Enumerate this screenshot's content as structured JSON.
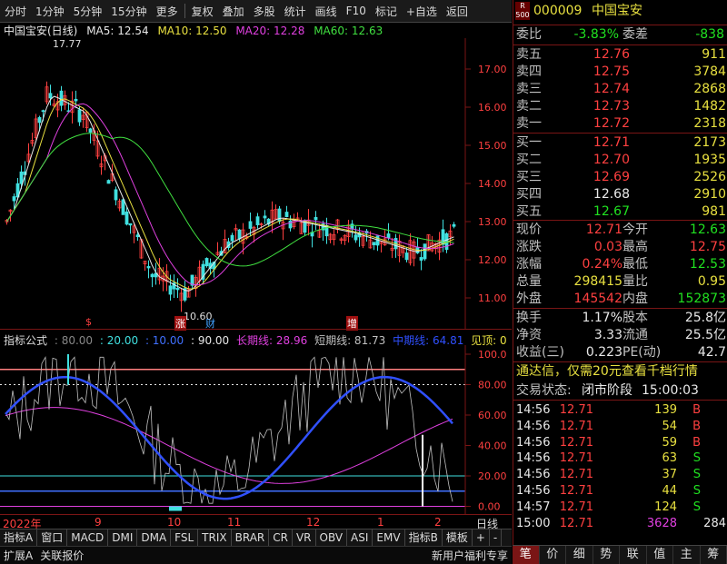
{
  "toolbar": {
    "items": [
      "分时",
      "1分钟",
      "5分钟",
      "15分钟",
      "更多",
      "复权",
      "叠加",
      "多股",
      "统计",
      "画线",
      "F10",
      "标记",
      "+自选",
      "返回"
    ]
  },
  "stock": {
    "title": "中国宝安(日线)",
    "code": "000009",
    "name": "中国宝安",
    "badge_top": "R",
    "badge_bottom": "500"
  },
  "ma": {
    "ma5": "MA5: 12.54",
    "ma10": "MA10: 12.50",
    "ma20": "MA20: 12.28",
    "ma60": "MA60: 12.63"
  },
  "colors": {
    "ma5": "#e8e8e8",
    "ma10": "#e8e040",
    "ma20": "#e040e0",
    "ma60": "#40e040",
    "up": "#ff4040",
    "down": "#40e0e0",
    "axis_frame": "#7a1515"
  },
  "main_chart": {
    "yaxis": [
      "17.00",
      "16.00",
      "15.00",
      "14.00",
      "13.00",
      "12.00",
      "11.00"
    ],
    "high_label": "17.77",
    "low_label": "10.60",
    "markers": [
      "$",
      "涨",
      "财",
      "增"
    ]
  },
  "indicator": {
    "name": "指标公式",
    "params": [
      ": 80.00",
      ": 20.00",
      ": 10.00",
      ": 90.00"
    ],
    "long_line": "长期线: 28.96",
    "short_line": "短期线: 81.73",
    "mid_line": "中期线: 64.81",
    "top_label": "见顶: 0",
    "yaxis": [
      "100.0",
      "80.00",
      "60.00",
      "40.00",
      "20.00",
      "0.00"
    ]
  },
  "date_axis": {
    "labels": [
      "2022年",
      "9",
      "10",
      "11",
      "12",
      "1",
      "2"
    ],
    "right_label": "日线"
  },
  "tabs": [
    "指标A",
    "窗口",
    "MACD",
    "DMI",
    "DMA",
    "FSL",
    "TRIX",
    "BRAR",
    "CR",
    "VR",
    "OBV",
    "ASI",
    "EMV",
    "指标B",
    "模板",
    "+",
    "-"
  ],
  "statusbar": {
    "left": [
      "扩展A",
      "关联报价"
    ],
    "right": "新用户福利专享"
  },
  "quote": {
    "webi_label": "委比",
    "webi_value": "-3.83%",
    "weicha_label": "委差",
    "weicha_value": "-838",
    "asks": [
      {
        "label": "卖五",
        "price": "12.76",
        "vol": "911"
      },
      {
        "label": "卖四",
        "price": "12.75",
        "vol": "3784"
      },
      {
        "label": "卖三",
        "price": "12.74",
        "vol": "2868"
      },
      {
        "label": "卖二",
        "price": "12.73",
        "vol": "1482"
      },
      {
        "label": "卖一",
        "price": "12.72",
        "vol": "2318"
      }
    ],
    "bids": [
      {
        "label": "买一",
        "price": "12.71",
        "vol": "2173"
      },
      {
        "label": "买二",
        "price": "12.70",
        "vol": "1935"
      },
      {
        "label": "买三",
        "price": "12.69",
        "vol": "2526"
      },
      {
        "label": "买四",
        "price": "12.68",
        "vol": "2910"
      },
      {
        "label": "买五",
        "price": "12.67",
        "vol": "981"
      }
    ],
    "stats": [
      {
        "l1": "现价",
        "v1": "12.71",
        "l2": "今开",
        "v2": "12.63"
      },
      {
        "l1": "涨跌",
        "v1": "0.03",
        "l2": "最高",
        "v2": "12.75"
      },
      {
        "l1": "涨幅",
        "v1": "0.24%",
        "l2": "最低",
        "v2": "12.53"
      },
      {
        "l1": "总量",
        "v1": "298415",
        "l2": "量比",
        "v2": "0.95"
      },
      {
        "l1": "外盘",
        "v1": "145542",
        "l2": "内盘",
        "v2": "152873"
      }
    ],
    "stats2": [
      {
        "l1": "换手",
        "v1": "1.17%",
        "l2": "股本",
        "v2": "25.8亿"
      },
      {
        "l1": "净资",
        "v1": "3.33",
        "l2": "流通",
        "v2": "25.5亿"
      },
      {
        "l1": "收益(三)",
        "v1": "0.223",
        "l2": "PE(动)",
        "v2": "42.7"
      }
    ],
    "promo": "通达信，仅需20元查看千档行情",
    "trade_status_label": "交易状态:",
    "trade_status": "闭市阶段",
    "trade_time": "15:00:03"
  },
  "ticks": [
    {
      "time": "14:56",
      "price": "12.71",
      "vol": "139",
      "side": "B"
    },
    {
      "time": "14:56",
      "price": "12.71",
      "vol": "54",
      "side": "B"
    },
    {
      "time": "14:56",
      "price": "12.71",
      "vol": "59",
      "side": "B"
    },
    {
      "time": "14:56",
      "price": "12.71",
      "vol": "63",
      "side": "S"
    },
    {
      "time": "14:56",
      "price": "12.71",
      "vol": "37",
      "side": "S"
    },
    {
      "time": "14:56",
      "price": "12.71",
      "vol": "44",
      "side": "S"
    },
    {
      "time": "14:57",
      "price": "12.71",
      "vol": "124",
      "side": "S"
    },
    {
      "time": "15:00",
      "price": "12.71",
      "vol": "3628",
      "side": "284"
    }
  ],
  "right_tabs": [
    "笔",
    "价",
    "细",
    "势",
    "联",
    "值",
    "主",
    "筹"
  ]
}
